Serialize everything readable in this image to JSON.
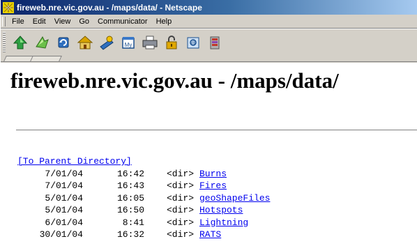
{
  "window": {
    "title": "fireweb.nre.vic.gov.au - /maps/data/ - Netscape"
  },
  "menu": {
    "items": [
      "File",
      "Edit",
      "View",
      "Go",
      "Communicator",
      "Help"
    ]
  },
  "toolbar": {
    "buttons": [
      {
        "icon": "back-icon"
      },
      {
        "icon": "forward-icon"
      },
      {
        "icon": "reload-icon"
      },
      {
        "icon": "home-icon"
      },
      {
        "icon": "search-icon"
      },
      {
        "icon": "my-netscape-icon"
      },
      {
        "icon": "print-icon"
      },
      {
        "icon": "security-icon"
      },
      {
        "icon": "shop-icon"
      },
      {
        "icon": "stop-icon"
      }
    ]
  },
  "page": {
    "heading": "fireweb.nre.vic.gov.au - /maps/data/",
    "parent_link": "[To Parent Directory]",
    "dir_tag": "<dir>",
    "entries": [
      {
        "date": "7/01/04",
        "time": "16:42",
        "name": "Burns"
      },
      {
        "date": "7/01/04",
        "time": "16:43",
        "name": "Fires"
      },
      {
        "date": "5/01/04",
        "time": "16:05",
        "name": "geoShapeFiles"
      },
      {
        "date": "5/01/04",
        "time": "16:50",
        "name": "Hotspots"
      },
      {
        "date": "6/01/04",
        "time": "8:41",
        "name": "Lightning"
      },
      {
        "date": "30/01/04",
        "time": "16:32",
        "name": "RATS"
      }
    ]
  },
  "colors": {
    "link": "#0000ee",
    "title_bar_start": "#0a246a",
    "title_bar_end": "#a6caf0",
    "chrome": "#d4d0c8"
  }
}
